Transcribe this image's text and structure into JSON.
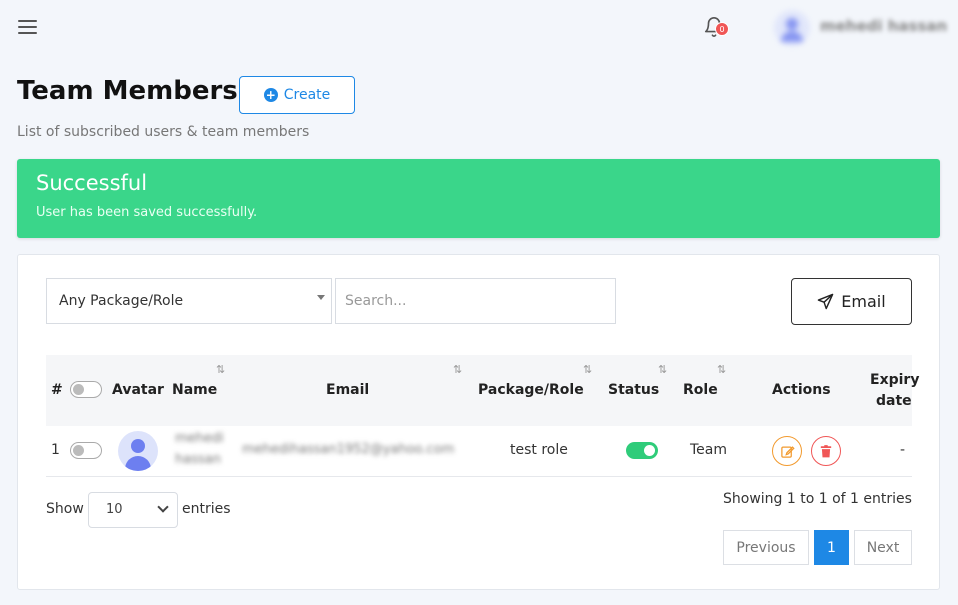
{
  "topbar": {
    "notification_count": "0",
    "user_name": "mehedi hassan"
  },
  "page": {
    "title": "Team Members",
    "create_label": "Create",
    "subtitle": "List of subscribed users & team members"
  },
  "alert": {
    "title": "Successful",
    "message": "User has been saved successfully."
  },
  "filters": {
    "role_select_value": "Any Package/Role",
    "search_placeholder": "Search...",
    "email_label": "Email"
  },
  "table": {
    "headers": {
      "index": "#",
      "avatar": "Avatar",
      "name": "Name",
      "email": "Email",
      "package_role": "Package/Role",
      "status": "Status",
      "role": "Role",
      "actions": "Actions",
      "expiry_line1": "Expiry",
      "expiry_line2": "date"
    },
    "rows": [
      {
        "index": "1",
        "name_line1": "mehedi",
        "name_line2": "hassan",
        "email": "mehedihassan1952@yahoo.com",
        "package_role": "test role",
        "status_active": true,
        "role": "Team",
        "expiry": "-"
      }
    ]
  },
  "footer": {
    "show_label": "Show",
    "page_length": "10",
    "entries_label": "entries",
    "info": "Showing 1 to 1 of 1 entries",
    "previous": "Previous",
    "current_page": "1",
    "next": "Next"
  },
  "colors": {
    "accent": "#1e88e5",
    "success": "#3ad68a",
    "toggle_on": "#2fcc7a",
    "edit": "#f29a2e",
    "delete": "#f05656"
  }
}
